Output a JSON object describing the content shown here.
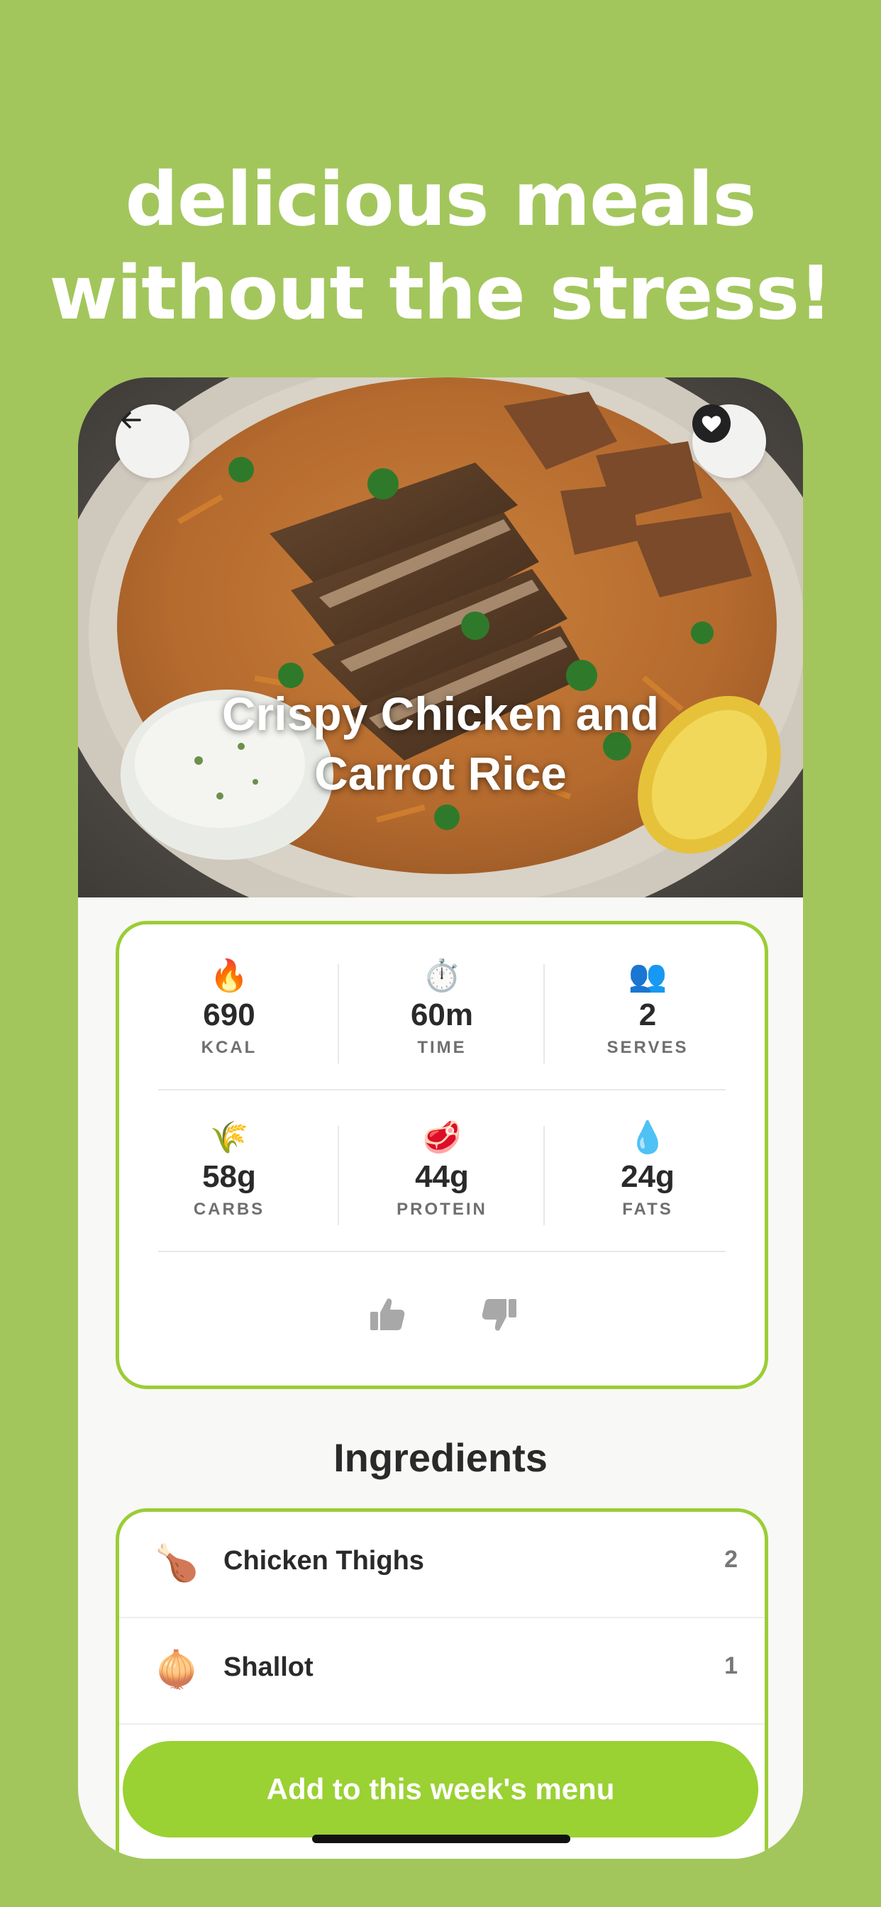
{
  "headline": {
    "line1": "delicious meals",
    "line2": "without the stress!"
  },
  "recipe": {
    "title_line1": "Crispy Chicken and",
    "title_line2": "Carrot Rice"
  },
  "icons": {
    "back": "arrow-left-icon",
    "favorite": "heart-icon",
    "like": "thumbs-up-icon",
    "dislike": "thumbs-down-icon"
  },
  "stats": [
    {
      "emoji": "🔥",
      "value": "690",
      "label": "KCAL"
    },
    {
      "emoji": "⏱️",
      "value": "60m",
      "label": "TIME"
    },
    {
      "emoji": "👥",
      "value": "2",
      "label": "SERVES"
    },
    {
      "emoji": "🌾",
      "value": "58g",
      "label": "CARBS"
    },
    {
      "emoji": "🥩",
      "value": "44g",
      "label": "PROTEIN"
    },
    {
      "emoji": "💧",
      "value": "24g",
      "label": "FATS"
    }
  ],
  "ingredients": {
    "title": "Ingredients",
    "items": [
      {
        "emoji": "🍗",
        "name": "Chicken Thighs",
        "qty": "2"
      },
      {
        "emoji": "🧅",
        "name": "Shallot",
        "qty": "1"
      }
    ]
  },
  "cta": {
    "label": "Add to this week's menu"
  },
  "colors": {
    "background": "#a2c65c",
    "accent": "#9bcd35",
    "button": "#9ad133"
  }
}
